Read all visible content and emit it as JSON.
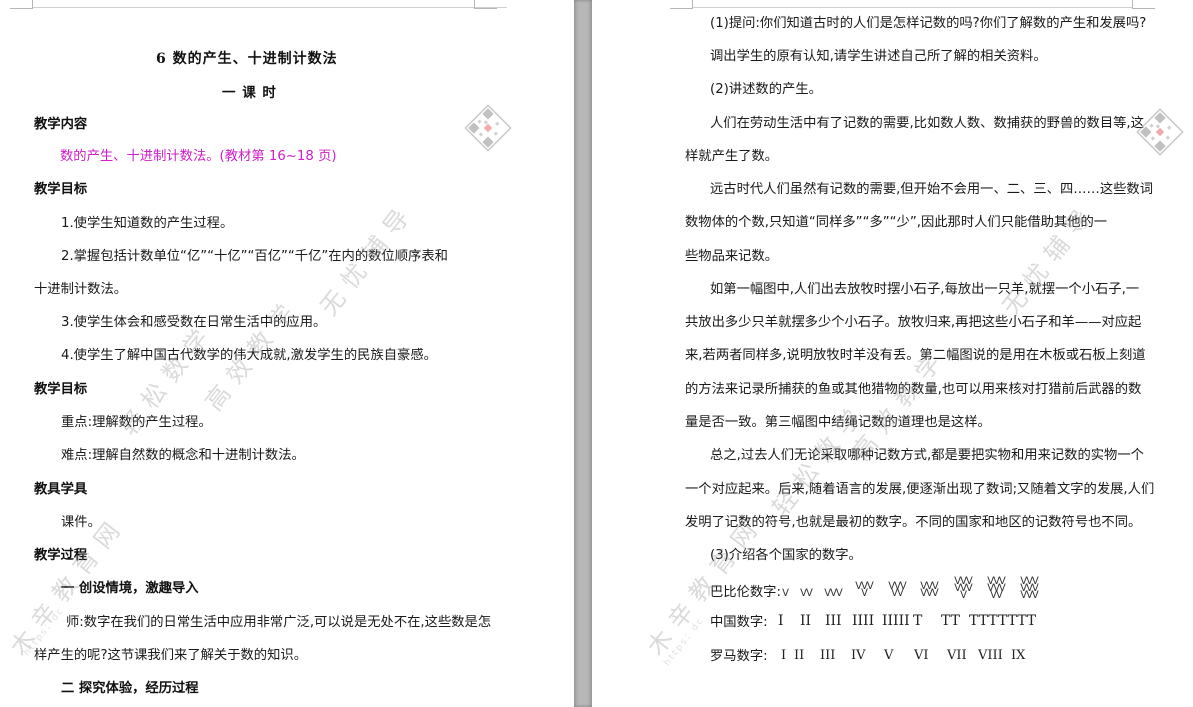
{
  "left_page": {
    "title": "6   数的产生、十进制计数法",
    "subtitle": "一   课  时",
    "lines": [
      {
        "id": "content_heading",
        "text": "教学内容"
      },
      {
        "id": "content_text",
        "text": "数的产生、十进制计数法。(教材第 16~18 页)"
      },
      {
        "id": "goal_heading",
        "text": "教学目标"
      },
      {
        "id": "goal_1",
        "text": "1.使学生知道数的产生过程。"
      },
      {
        "id": "goal_2a",
        "text": "2.掌握包括计数单位“亿”“十亿”“百亿”“千亿”在内的数位顺序表和"
      },
      {
        "id": "goal_2b",
        "text": "十进制计数法。"
      },
      {
        "id": "goal_3",
        "text": "3.使学生体会和感受数在日常生活中的应用。"
      },
      {
        "id": "goal_4",
        "text": "4.使学生了解中国古代数学的伟大成就,激发学生的民族自豪感。"
      },
      {
        "id": "goal2_heading",
        "text": "教学目标"
      },
      {
        "id": "key_point",
        "text": "重点:理解数的产生过程。"
      },
      {
        "id": "difficult_point",
        "text": "难点:理解自然数的概念和十进制计数法。"
      },
      {
        "id": "tools_heading",
        "text": "教具学具"
      },
      {
        "id": "tools_text",
        "text": "课件。"
      },
      {
        "id": "process_heading",
        "text": "教学过程"
      },
      {
        "id": "step_1",
        "text": "一  创设情境，激趣导入"
      },
      {
        "id": "teacher_a",
        "text": "师:数字在我们的日常生活中应用非常广泛,可以说是无处不在,这些数是怎"
      },
      {
        "id": "teacher_b",
        "text": "样产生的呢?这节课我们来了解关于数的知识。"
      },
      {
        "id": "step_2",
        "text": "二  探究体验，经历过程"
      }
    ]
  },
  "right_page": {
    "lines": [
      {
        "id": "r1",
        "text": "(1)提问:你们知道古时的人们是怎样记数的吗?你们了解数的产生和发展吗?"
      },
      {
        "id": "r2",
        "text": "调出学生的原有认知,请学生讲述自己所了解的相关资料。"
      },
      {
        "id": "r3",
        "text": "(2)讲述数的产生。"
      },
      {
        "id": "r4",
        "text": "人们在劳动生活中有了记数的需要,比如数人数、数捕获的野兽的数目等,这"
      },
      {
        "id": "r5",
        "text": "样就产生了数。"
      },
      {
        "id": "r6",
        "text": "远古时代人们虽然有记数的需要,但开始不会用一、二、三、四……这些数词"
      },
      {
        "id": "r7",
        "text": "数物体的个数,只知道“同样多”“多”“少”,因此那时人们只能借助其他的一"
      },
      {
        "id": "r8",
        "text": "些物品来记数。"
      },
      {
        "id": "r9",
        "text": "如第一幅图中,人们出去放牧时摆小石子,每放出一只羊,就摆一个小石子,一"
      },
      {
        "id": "r10",
        "text": "共放出多少只羊就摆多少个小石子。放牧归来,再把这些小石子和羊——对应起"
      },
      {
        "id": "r11",
        "text": "来,若两者同样多,说明放牧时羊没有丢。第二幅图说的是用在木板或石板上刻道"
      },
      {
        "id": "r12",
        "text": "的方法来记录所捕获的鱼或其他猎物的数量,也可以用来核对打猎前后武器的数"
      },
      {
        "id": "r13",
        "text": "量是否一致。第三幅图中结绳记数的道理也是这样。"
      },
      {
        "id": "r14",
        "text": "总之,过去人们无论采取哪种记数方式,都是要把实物和用来记数的实物一个"
      },
      {
        "id": "r15",
        "text": "一个对应起来。后来,随着语言的发展,便逐渐出现了数词;又随着文字的发展,人们"
      },
      {
        "id": "r16",
        "text": "发明了记数的符号,也就是最初的数字。不同的国家和地区的记数符号也不同。"
      },
      {
        "id": "r17",
        "text": "(3)介绍各个国家的数字。"
      }
    ],
    "numerals": {
      "babylonian_label": "巴比伦数字:",
      "babylonian": [
        "ᐯ",
        "ᐯᐯ",
        "ᐯᐯᐯ",
        "ᐯᐯᐯ\nᐯ",
        "ᐯᐯᐯ\nᐯᐯ",
        "ᐯᐯᐯ\nᐯᐯᐯ",
        "ᐯᐯᐯ\nᐯᐯᐯ\nᐯ",
        "ᐯᐯᐯ\nᐯᐯᐯ\nᐯᐯ",
        "ᐯᐯᐯ\nᐯᐯᐯ\nᐯᐯᐯ"
      ],
      "chinese_label": "中国数字:",
      "chinese": [
        "I",
        "II",
        "III",
        "IIII",
        "IIIII",
        "T",
        "TT",
        "TTT",
        "TTTT"
      ],
      "roman_label": "罗马数字:",
      "roman": [
        "I",
        "II",
        "III",
        "IV",
        "V",
        "VI",
        "VII",
        "VIII",
        "IX"
      ]
    }
  },
  "watermark": {
    "brand_a": "轻松数学",
    "brand_b": "高效教学",
    "brand_c": "无忧辅导",
    "brand_d": "木辛教育网",
    "url": "https：dc"
  },
  "colors": {
    "magenta": "#d020c8",
    "gutter": "#b7b7b7",
    "watermark_qr_accent": "#e0484c"
  }
}
